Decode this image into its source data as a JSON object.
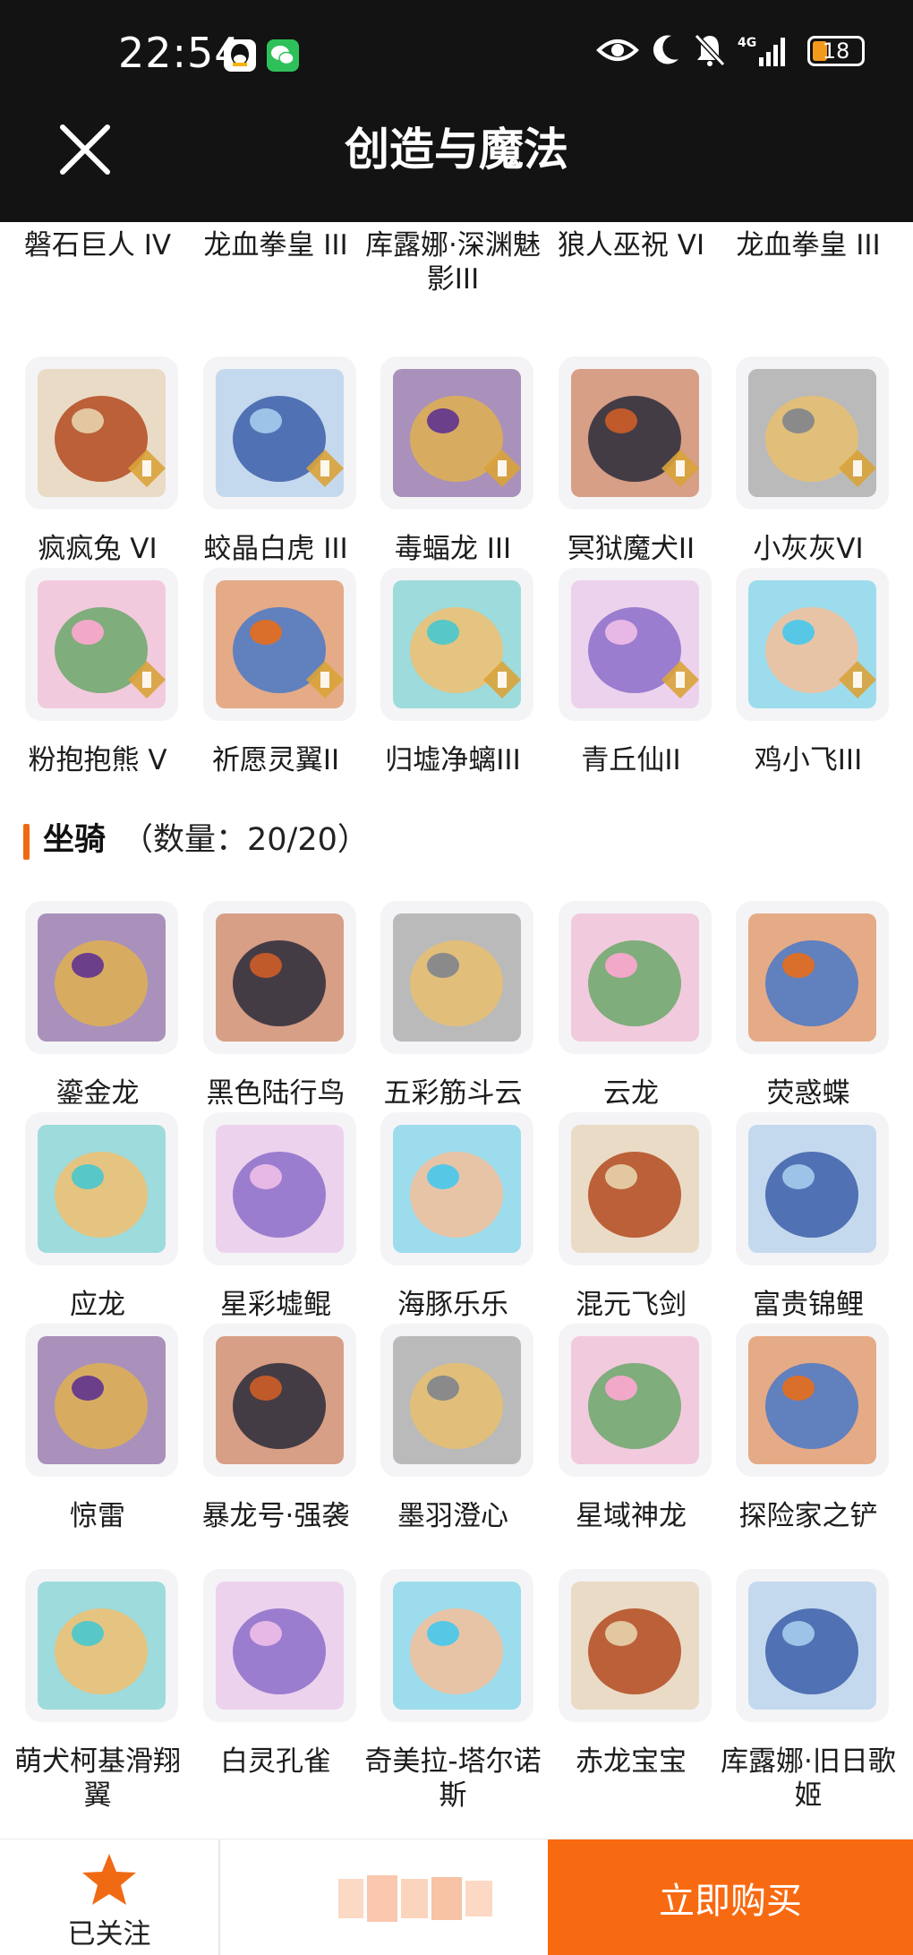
{
  "status_bar": {
    "time": "22:54",
    "network": "4G",
    "battery": "18"
  },
  "header": {
    "title": "创造与魔法"
  },
  "pets_partial": [
    "磐石巨人 IV",
    "龙血拳皇 III",
    "库露娜·深渊魅影III",
    "狼人巫祝 VI",
    "龙血拳皇 III"
  ],
  "pets": [
    [
      "疯疯兔 VI",
      "蛟晶白虎 III",
      "毒蝠龙 III",
      "冥狱魔犬II",
      "小灰灰VI"
    ],
    [
      "粉抱抱熊 V",
      "祈愿灵翼II",
      "归墟净螭III",
      "青丘仙II",
      "鸡小飞III"
    ]
  ],
  "mounts_section": {
    "title": "坐骑",
    "count": "（数量：20/20）"
  },
  "mounts": [
    [
      "鎏金龙",
      "黑色陆行鸟",
      "五彩筋斗云",
      "云龙",
      "荧惑蝶"
    ],
    [
      "应龙",
      "星彩墟鲲",
      "海豚乐乐",
      "混元飞剑",
      "富贵锦鲤"
    ],
    [
      "惊雷",
      "暴龙号·强袭",
      "墨羽澄心",
      "星域神龙",
      "探险家之铲"
    ],
    [
      "萌犬柯基滑翔翼",
      "白灵孔雀",
      "奇美拉-塔尔诺斯",
      "赤龙宝宝",
      "库露娜·旧日歌姬"
    ]
  ],
  "bottom_bar": {
    "follow_label": "已关注",
    "buy_label": "立即购买"
  },
  "colors": {
    "accent": "#f86a12",
    "header_bg": "#131313",
    "star": "#f06a14",
    "tile_bg": "#f4f4f6"
  },
  "icons": {
    "close": "close-icon",
    "star": "star-icon",
    "eye": "eye-icon",
    "moon": "moon-icon",
    "mute": "bell-muted-icon",
    "signal": "signal-icon"
  }
}
